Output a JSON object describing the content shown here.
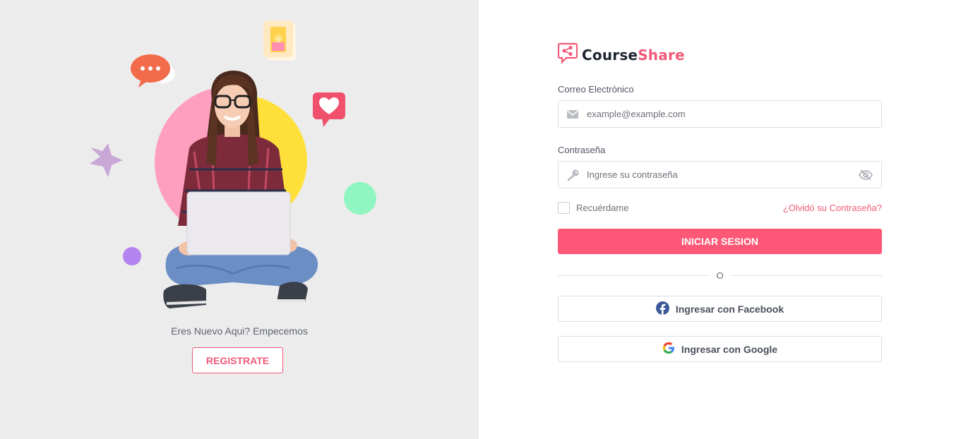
{
  "left_panel": {
    "welcome_text": "Eres Nuevo Aqui? Empecemos",
    "register_label": "REGISTRATE"
  },
  "brand": {
    "name_part1": "Course",
    "name_part2": "Share",
    "logo_icon": "share-chat-icon"
  },
  "form": {
    "email": {
      "label": "Correo Electrónico",
      "placeholder": "example@example.com",
      "value": "",
      "icon": "envelope-icon"
    },
    "password": {
      "label": "Contraseña",
      "placeholder": "Ingrese su contraseña",
      "value": "",
      "icon": "key-icon",
      "toggle_icon": "eye-slash-icon"
    },
    "remember_label": "Recuérdame",
    "forgot_label": "¿Olvidó su Contraseña?",
    "submit_label": "INICIAR SESION",
    "divider_text": "O",
    "facebook_label": "Ingresar con Facebook",
    "google_label": "Ingresar con Google"
  },
  "colors": {
    "accent": "#fd5877",
    "left_bg": "#ececec",
    "facebook": "#3b5998",
    "google": "#ea4335"
  }
}
